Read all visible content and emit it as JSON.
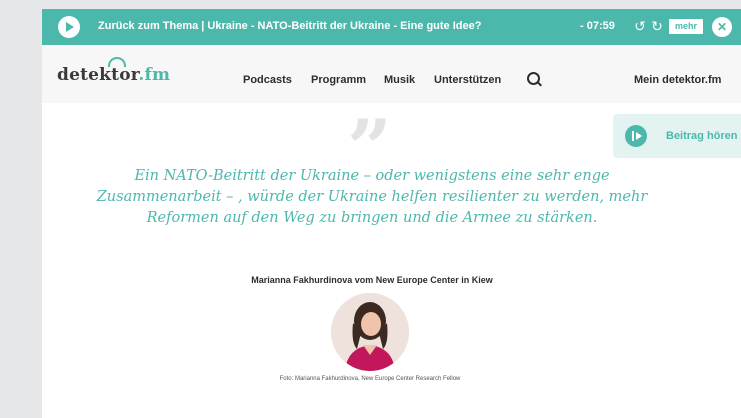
{
  "player": {
    "title": "Zurück zum Thema | Ukraine - NATO-Beitritt der Ukraine - Eine gute Idee?",
    "time": "- 07:59",
    "more_label": "mehr",
    "play_icon": "play-icon",
    "rewind_icon": "rewind-icon",
    "forward_icon": "forward-icon",
    "close_icon": "close-icon"
  },
  "nav": {
    "logo_main": "detektor",
    "logo_suffix": ".fm",
    "links": [
      "Podcasts",
      "Programm",
      "Musik",
      "Unterstützen"
    ],
    "account_label": "Mein detektor.fm"
  },
  "listen": {
    "label": "Beitrag hören"
  },
  "quote": {
    "mark": "”",
    "text": "Ein NATO-Beitritt der Ukraine – oder wenigstens eine sehr enge Zusammenarbeit – , würde der Ukraine helfen resilienter zu werden, mehr Reformen auf den Weg zu bringen und die Armee zu stärken.",
    "author": "Marianna Fakhurdinova vom New Europe Center in Kiew",
    "caption": "Foto: Marianna Fakhurdinova, New Europe Center Research Fellow"
  },
  "colors": {
    "accent": "#4cb8ab",
    "background": "#e6e7e8",
    "nav_bg": "#f7f7f7"
  }
}
